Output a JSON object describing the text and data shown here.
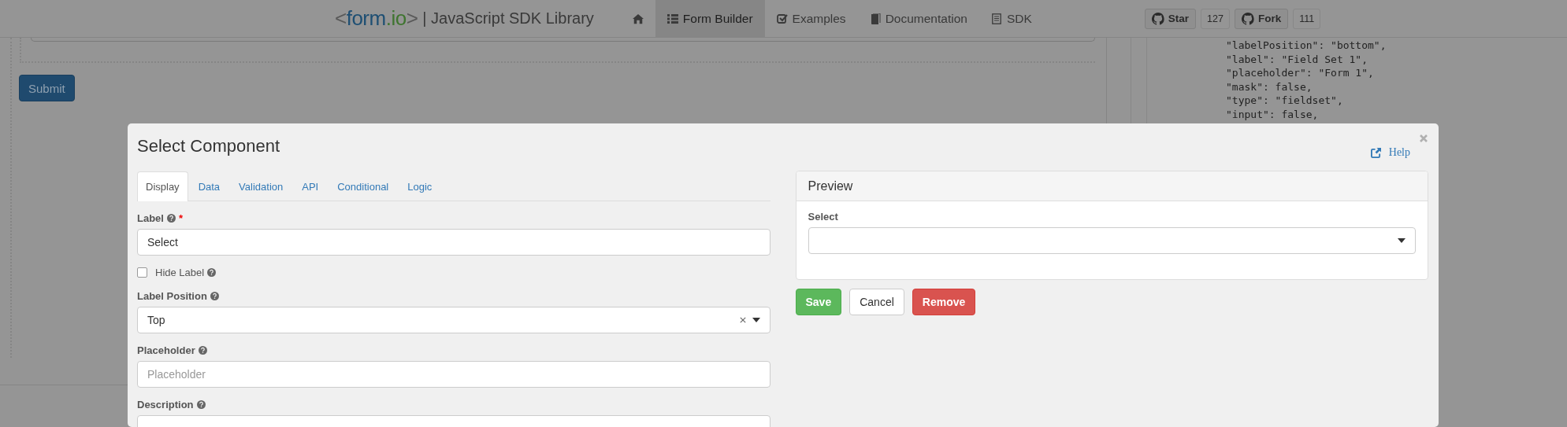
{
  "navbar": {
    "logo": {
      "open": "<",
      "name": "form",
      "suffix": ".io",
      "close": ">"
    },
    "title": "| JavaScript SDK Library",
    "links": [
      {
        "kind": "home",
        "selected": false
      },
      {
        "kind": "builder",
        "label": "Form Builder",
        "selected": true
      },
      {
        "kind": "examples",
        "label": "Examples",
        "selected": false
      },
      {
        "kind": "docs",
        "label": "Documentation",
        "selected": false
      },
      {
        "kind": "sdk",
        "label": "SDK",
        "selected": false
      }
    ],
    "github": [
      {
        "label": "Star",
        "count": "127"
      },
      {
        "label": "Fork",
        "count": "111"
      }
    ]
  },
  "builder": {
    "submit": "Submit"
  },
  "code_lines": [
    "\"labelPosition\": \"bottom\",",
    "\"label\": \"Field Set 1\",",
    "\"placeholder\": \"Form 1\",",
    "\"mask\": false,",
    "\"type\": \"fieldset\",",
    "\"input\": false,"
  ],
  "modal": {
    "title": "Select Component",
    "help": "Help",
    "tabs": [
      {
        "label": "Display",
        "selected": true
      },
      {
        "label": "Data",
        "selected": false
      },
      {
        "label": "Validation",
        "selected": false
      },
      {
        "label": "API",
        "selected": false
      },
      {
        "label": "Conditional",
        "selected": false
      },
      {
        "label": "Logic",
        "selected": false
      }
    ],
    "fields": [
      {
        "kind": "text",
        "label": "Label",
        "help": true,
        "required_mark": "*",
        "value": "Select"
      },
      {
        "kind": "checkbox",
        "label": "Hide Label",
        "help": true,
        "checked": false
      },
      {
        "kind": "select",
        "label": "Label Position",
        "help": true,
        "value": "Top",
        "clearable": true
      },
      {
        "kind": "text",
        "label": "Placeholder",
        "help": true,
        "placeholder": "Placeholder"
      },
      {
        "kind": "text",
        "label": "Description",
        "help": true
      }
    ],
    "preview": {
      "title": "Preview",
      "field_label": "Select"
    },
    "buttons": [
      {
        "kind": "save",
        "label": "Save"
      },
      {
        "kind": "cancel",
        "label": "Cancel"
      },
      {
        "kind": "remove",
        "label": "Remove"
      }
    ]
  }
}
